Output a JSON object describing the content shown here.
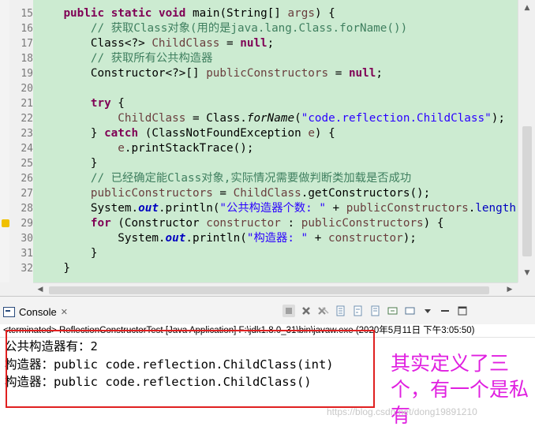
{
  "editor": {
    "line_numbers": [
      "15",
      "16",
      "17",
      "18",
      "19",
      "20",
      "21",
      "22",
      "23",
      "24",
      "25",
      "26",
      "27",
      "28",
      "29",
      "30",
      "31",
      "32"
    ],
    "lines": [
      [
        {
          "t": "    "
        },
        {
          "t": "public",
          "c": "kw"
        },
        {
          "t": " "
        },
        {
          "t": "static",
          "c": "kw"
        },
        {
          "t": " "
        },
        {
          "t": "void",
          "c": "kw"
        },
        {
          "t": " main(String[] "
        },
        {
          "t": "args",
          "c": "var"
        },
        {
          "t": ") {"
        }
      ],
      [
        {
          "t": "        "
        },
        {
          "t": "// 获取Class对象(用的是java.lang.Class.forName())",
          "c": "cm"
        }
      ],
      [
        {
          "t": "        Class<?> "
        },
        {
          "t": "ChildClass",
          "c": "var"
        },
        {
          "t": " = "
        },
        {
          "t": "null",
          "c": "kw"
        },
        {
          "t": ";"
        }
      ],
      [
        {
          "t": "        "
        },
        {
          "t": "// 获取所有公共构造器",
          "c": "cm"
        }
      ],
      [
        {
          "t": "        Constructor<?>[] "
        },
        {
          "t": "publicConstructors",
          "c": "var"
        },
        {
          "t": " = "
        },
        {
          "t": "null",
          "c": "kw"
        },
        {
          "t": ";"
        }
      ],
      [
        {
          "t": ""
        }
      ],
      [
        {
          "t": "        "
        },
        {
          "t": "try",
          "c": "kw"
        },
        {
          "t": " {"
        }
      ],
      [
        {
          "t": "            "
        },
        {
          "t": "ChildClass",
          "c": "var"
        },
        {
          "t": " = Class."
        },
        {
          "t": "forName",
          "c": "it"
        },
        {
          "t": "("
        },
        {
          "t": "\"code.reflection.ChildClass\"",
          "c": "str"
        },
        {
          "t": ");"
        }
      ],
      [
        {
          "t": "        } "
        },
        {
          "t": "catch",
          "c": "kw"
        },
        {
          "t": " (ClassNotFoundException "
        },
        {
          "t": "e",
          "c": "var"
        },
        {
          "t": ") {"
        }
      ],
      [
        {
          "t": "            "
        },
        {
          "t": "e",
          "c": "var"
        },
        {
          "t": ".printStackTrace();"
        }
      ],
      [
        {
          "t": "        }"
        }
      ],
      [
        {
          "t": "        "
        },
        {
          "t": "// 已经确定能Class对象,实际情况需要做判断类加载是否成功",
          "c": "cm"
        }
      ],
      [
        {
          "t": "        "
        },
        {
          "t": "publicConstructors",
          "c": "var"
        },
        {
          "t": " = "
        },
        {
          "t": "ChildClass",
          "c": "var"
        },
        {
          "t": ".getConstructors();"
        }
      ],
      [
        {
          "t": "        System."
        },
        {
          "t": "out",
          "c": "static"
        },
        {
          "t": ".println("
        },
        {
          "t": "\"公共构造器个数: \"",
          "c": "str"
        },
        {
          "t": " + "
        },
        {
          "t": "publicConstructors",
          "c": "var"
        },
        {
          "t": "."
        },
        {
          "t": "length",
          "c": "fld"
        },
        {
          "t": ");"
        }
      ],
      [
        {
          "t": "        "
        },
        {
          "t": "for",
          "c": "kw"
        },
        {
          "t": " (Constructor "
        },
        {
          "t": "constructor",
          "c": "var"
        },
        {
          "t": " : "
        },
        {
          "t": "publicConstructors",
          "c": "var"
        },
        {
          "t": ") {"
        }
      ],
      [
        {
          "t": "            System."
        },
        {
          "t": "out",
          "c": "static"
        },
        {
          "t": ".println("
        },
        {
          "t": "\"构造器: \"",
          "c": "str"
        },
        {
          "t": " + "
        },
        {
          "t": "constructor",
          "c": "var"
        },
        {
          "t": ");"
        }
      ],
      [
        {
          "t": "        }"
        }
      ],
      [
        {
          "t": "    }"
        }
      ]
    ]
  },
  "console": {
    "tab_label": "Console",
    "tab_close": "✕",
    "status": "<terminated> ReflectionConstructorTest [Java Application] F:\\jdk1.8.0_31\\bin\\javaw.exe (2020年5月11日 下午3:05:50)",
    "output": [
      "公共构造器有：2",
      "构造器：public code.reflection.ChildClass(int)",
      "构造器：public code.reflection.ChildClass()"
    ]
  },
  "annotation": {
    "text": "其实定义了三个，有一个是私有"
  },
  "watermark": "https://blog.csdn.net/dong19891210",
  "colors": {
    "code_bg": "#ccebd1",
    "keyword": "#7f0055",
    "comment": "#3f7f5f",
    "string": "#2a00ff",
    "annotation": "#e020e0",
    "highlight_box": "#e02020"
  },
  "icons": [
    "console-icon",
    "close-icon",
    "terminate-icon",
    "remove-launch-icon",
    "remove-all-icon",
    "scroll-lock-icon",
    "word-wrap-icon",
    "pin-icon",
    "display-console-icon",
    "open-console-icon",
    "view-menu-icon",
    "minimize-icon",
    "maximize-icon",
    "warning-marker-icon"
  ]
}
